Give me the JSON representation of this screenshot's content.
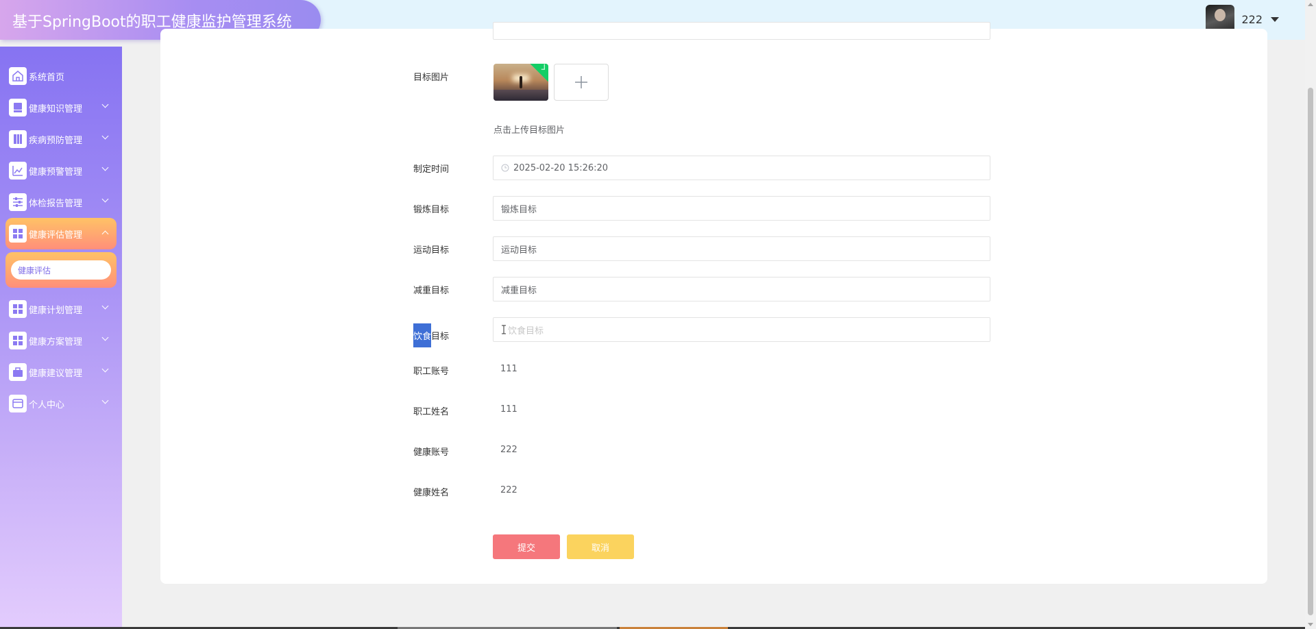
{
  "header": {
    "app_title": "基于SpringBoot的职工健康监护管理系统",
    "username": "222"
  },
  "sidebar": {
    "items": [
      {
        "label": "系统首页",
        "icon": "home-icon"
      },
      {
        "label": "健康知识管理",
        "icon": "book-icon"
      },
      {
        "label": "疾病预防管理",
        "icon": "bookmark-icon"
      },
      {
        "label": "健康预警管理",
        "icon": "chart-icon"
      },
      {
        "label": "体检报告管理",
        "icon": "sliders-icon"
      },
      {
        "label": "健康评估管理",
        "icon": "grid-icon"
      },
      {
        "label": "健康计划管理",
        "icon": "grid-icon"
      },
      {
        "label": "健康方案管理",
        "icon": "grid-icon"
      },
      {
        "label": "健康建议管理",
        "icon": "briefcase-icon"
      },
      {
        "label": "个人中心",
        "icon": "card-icon"
      }
    ],
    "active_index": 5,
    "submenu_label": "健康评估"
  },
  "form": {
    "image_label": "目标图片",
    "upload_tip": "点击上传目标图片",
    "time_label": "制定时间",
    "time_value": "2025-02-20 15:26:20",
    "exercise_label": "锻炼目标",
    "exercise_placeholder": "锻炼目标",
    "sport_label": "运动目标",
    "sport_placeholder": "运动目标",
    "weight_label": "减重目标",
    "weight_placeholder": "减重目标",
    "diet_label_highlight": "饮食",
    "diet_label_rest": "目标",
    "diet_placeholder": "饮食目标",
    "staff_account_label": "职工账号",
    "staff_account_value": "111",
    "staff_name_label": "职工姓名",
    "staff_name_value": "111",
    "health_account_label": "健康账号",
    "health_account_value": "222",
    "health_name_label": "健康姓名",
    "health_name_value": "222"
  },
  "buttons": {
    "submit": "提交",
    "cancel": "取消"
  },
  "colors": {
    "sidebar_top": "#8673f2",
    "active_menu": "#ffc266",
    "submit": "#f5777c",
    "cancel": "#fbd35e",
    "header_bg": "#e3f4fd"
  }
}
